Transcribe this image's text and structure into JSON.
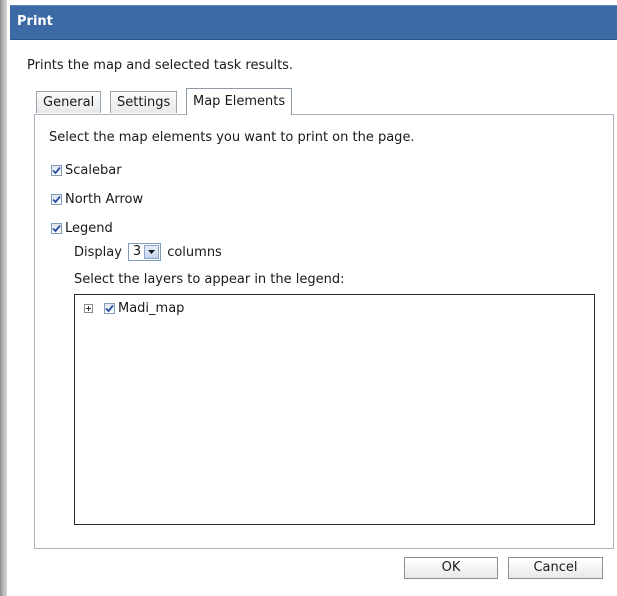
{
  "dialog": {
    "title": "Print",
    "description": "Prints the map and selected task results."
  },
  "tabs": [
    {
      "label": "General",
      "active": false
    },
    {
      "label": "Settings",
      "active": false
    },
    {
      "label": "Map Elements",
      "active": true
    }
  ],
  "panel": {
    "instruction": "Select the map elements you want to print on the page.",
    "elements": [
      {
        "label": "Scalebar",
        "checked": true
      },
      {
        "label": "North Arrow",
        "checked": true
      },
      {
        "label": "Legend",
        "checked": true
      }
    ],
    "display": {
      "prefix": "Display",
      "columns_value": "3",
      "suffix": "columns"
    },
    "layers_label": "Select the layers to appear in the legend:",
    "layers": [
      {
        "label": "Madi_map",
        "checked": true,
        "expander": "+"
      }
    ]
  },
  "buttons": {
    "ok": "OK",
    "cancel": "Cancel"
  },
  "colors": {
    "titlebar": "#3c6aa5",
    "checkmark": "#2b4fa8"
  },
  "icons": {
    "checkmark": "checkmark-icon",
    "dropdown": "chevron-down-icon",
    "expand": "plus-icon"
  }
}
